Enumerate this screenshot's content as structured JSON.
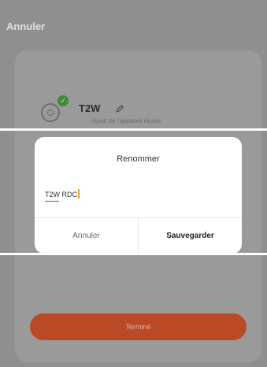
{
  "header": {
    "cancel_label": "Annuler"
  },
  "device": {
    "name": "T2W",
    "subtitle": "Ajout de l'appareil réussi",
    "status_icon": "check-icon",
    "device_icon": "device-icon",
    "edit_icon": "pencil-icon"
  },
  "rename_dialog": {
    "title": "Renommer",
    "input_value": "T2W RDC",
    "cancel_label": "Annuler",
    "save_label": "Sauvegarder"
  },
  "footer": {
    "done_label": "Terminé"
  },
  "colors": {
    "accent": "#b94a25",
    "success": "#3f8a3c",
    "cursor": "#f0a020",
    "input_underline": "#2f6fdf"
  }
}
